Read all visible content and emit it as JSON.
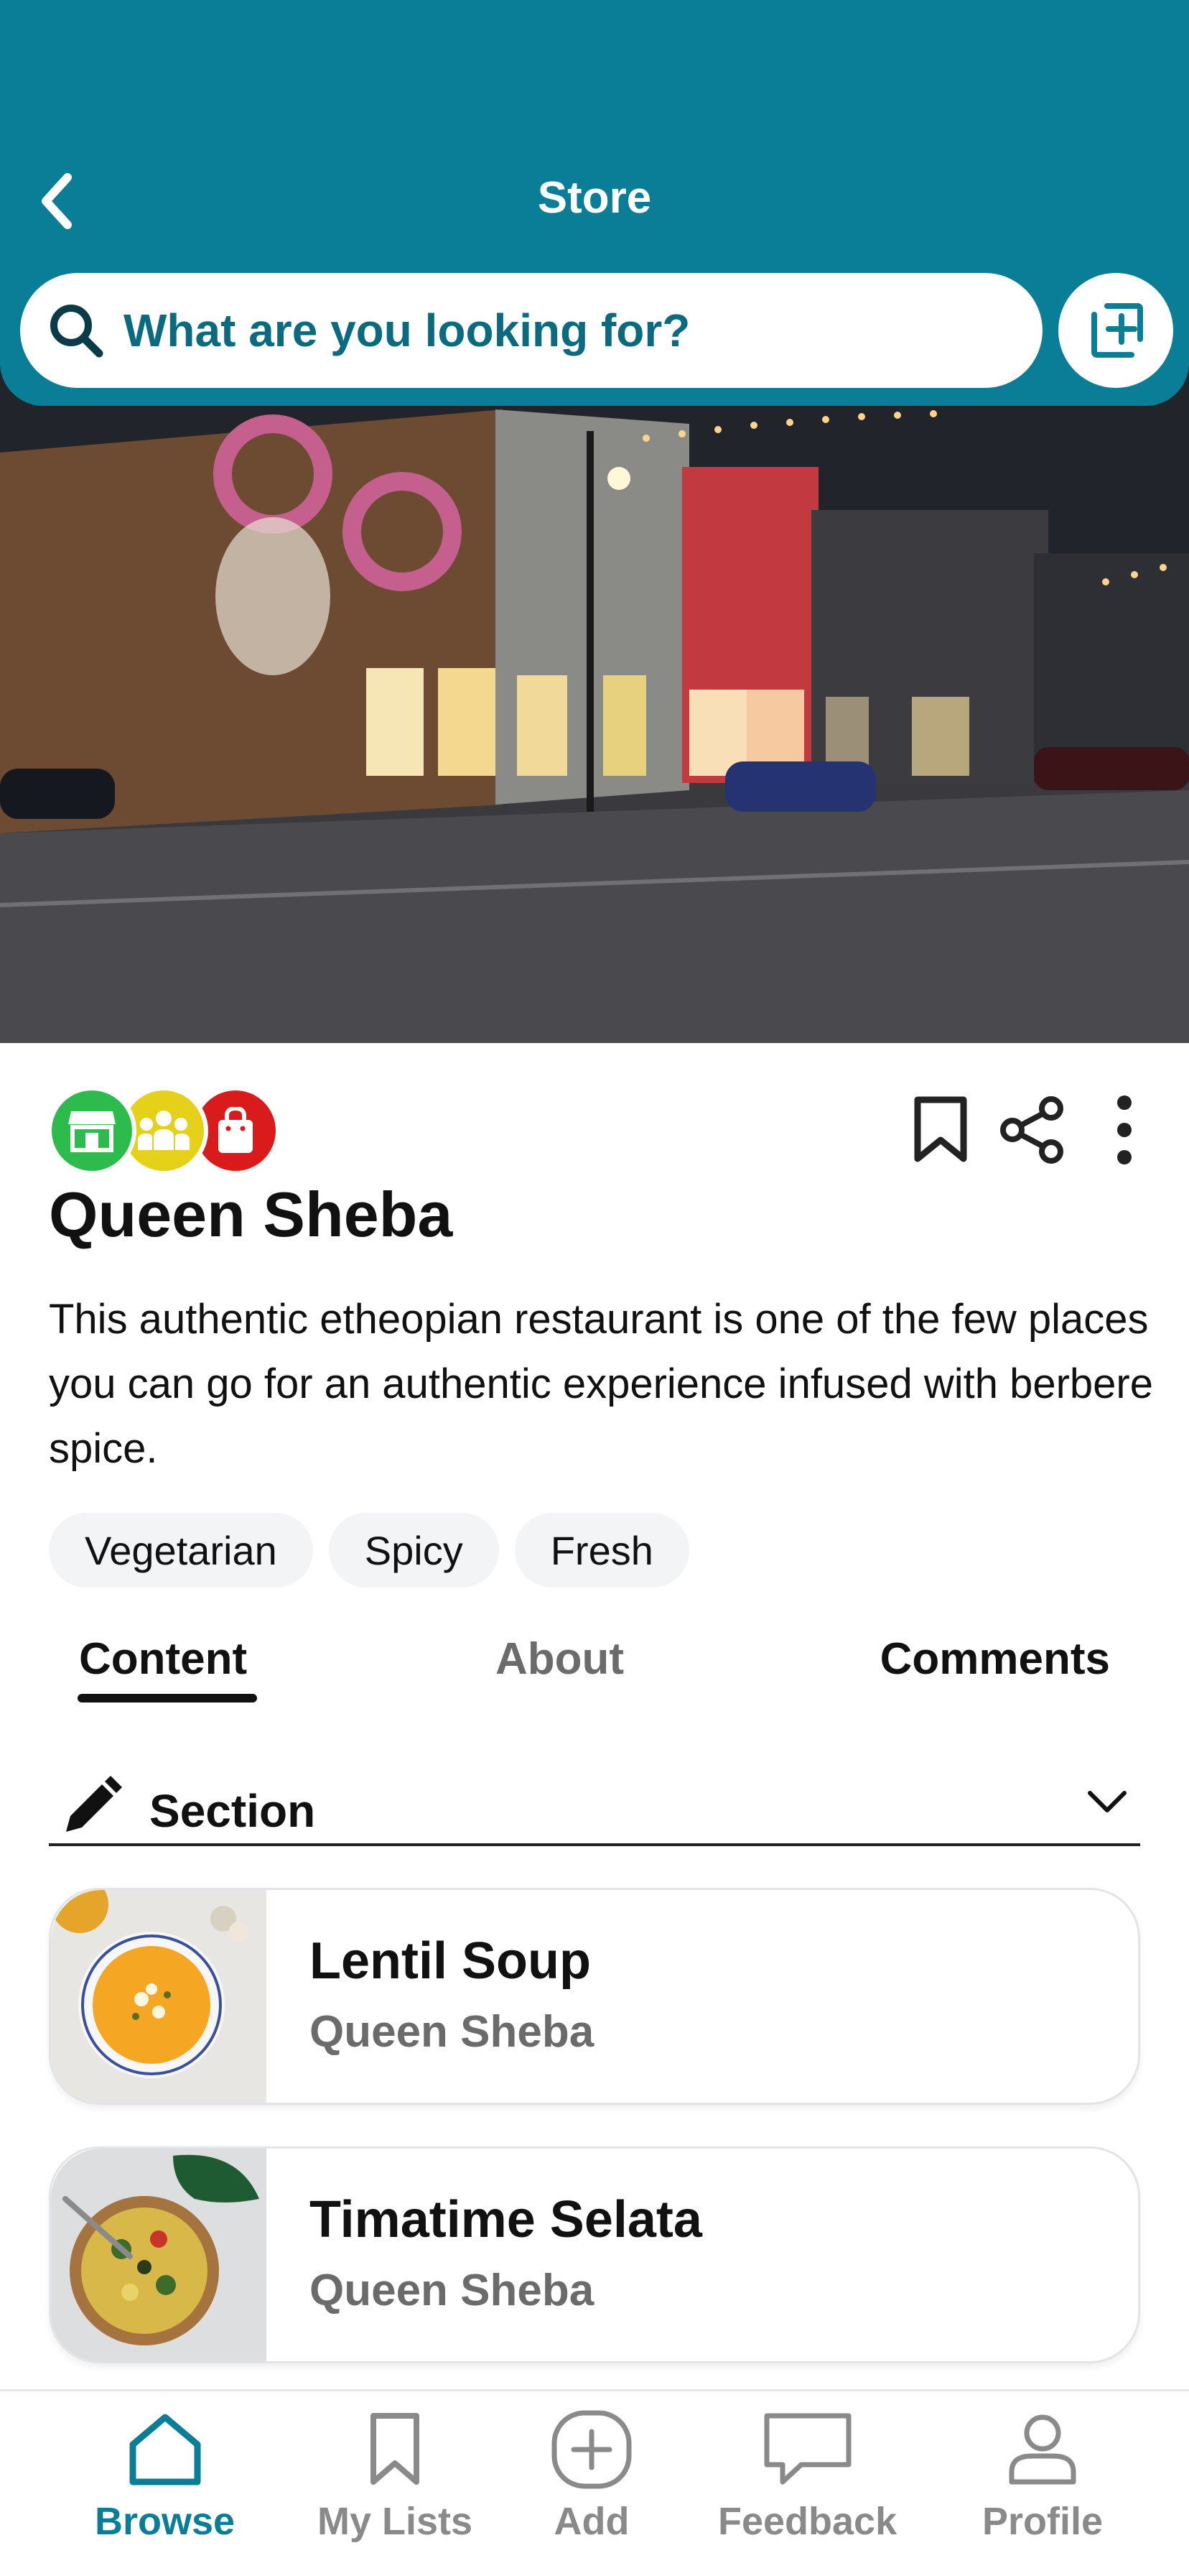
{
  "header": {
    "title": "Store",
    "search_placeholder": "What are you looking for?"
  },
  "colors": {
    "brand": "#0a7d97",
    "category_store": "#2dbb4e",
    "category_group": "#e6d11a",
    "category_shopping": "#d91b1b"
  },
  "store": {
    "name": "Queen Sheba",
    "description": "This authentic etheopian restaurant is one of the few places you can go for an authentic experience infused with berbere spice.",
    "category_icons": [
      "storefront-icon",
      "group-icon",
      "shopping-bag-icon"
    ],
    "tags": [
      "Vegetarian",
      "Spicy",
      "Fresh"
    ]
  },
  "tabs": [
    {
      "label": "Content",
      "active": true
    },
    {
      "label": "About",
      "active": false
    },
    {
      "label": "Comments",
      "active": false
    }
  ],
  "section": {
    "label": "Section"
  },
  "items": [
    {
      "title": "Lentil Soup",
      "subtitle": "Queen Sheba"
    },
    {
      "title": "Timatime Selata",
      "subtitle": "Queen Sheba"
    }
  ],
  "bottom_nav": [
    {
      "label": "Browse",
      "icon": "home-icon",
      "active": true
    },
    {
      "label": "My Lists",
      "icon": "bookmark-icon",
      "active": false
    },
    {
      "label": "Add",
      "icon": "plus-circle-icon",
      "active": false
    },
    {
      "label": "Feedback",
      "icon": "chat-bubble-icon",
      "active": false
    },
    {
      "label": "Profile",
      "icon": "person-icon",
      "active": false
    }
  ]
}
